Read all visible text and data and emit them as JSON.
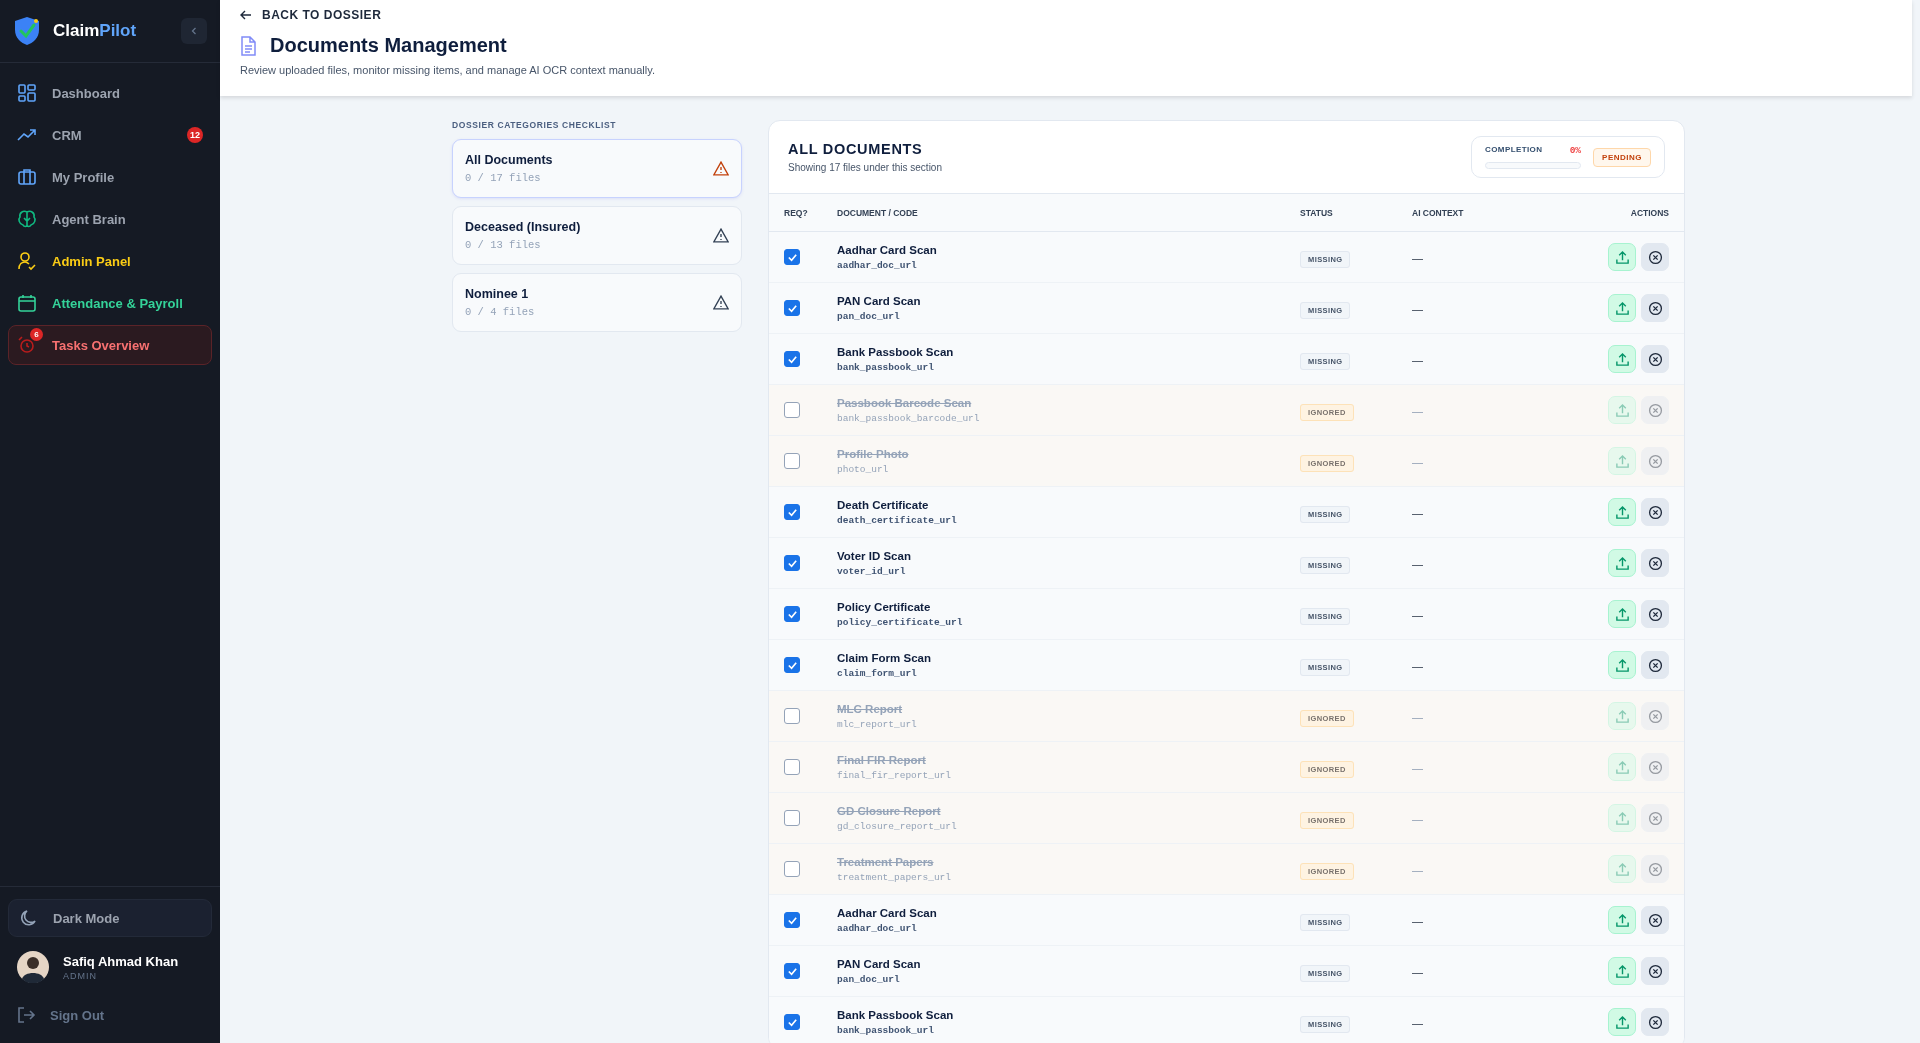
{
  "brand": {
    "name_part_1": "Claim",
    "name_part_2": "Pilot"
  },
  "sidebar": {
    "items": [
      {
        "label": "Dashboard",
        "color": "#9ca3af",
        "selected": false
      },
      {
        "label": "CRM",
        "color": "#9ca3af",
        "selected": false,
        "badge": "12"
      },
      {
        "label": "My Profile",
        "color": "#9ca3af",
        "selected": false
      },
      {
        "label": "Agent Brain",
        "color": "#9ca3af",
        "selected": false
      },
      {
        "label": "Admin Panel",
        "color": "#facc15",
        "selected": false
      },
      {
        "label": "Attendance & Payroll",
        "color": "#34d399",
        "selected": false
      },
      {
        "label": "Tasks Overview",
        "color": "#f87171",
        "selected": true,
        "badge": "6"
      }
    ],
    "dark_mode": {
      "label": "Dark Mode"
    },
    "user": {
      "name": "Safiq Ahmad Khan",
      "role": "ADMIN"
    },
    "sign_out": "Sign Out"
  },
  "header": {
    "back_link": "BACK TO DOSSIER",
    "title": "Documents Management",
    "subtitle": "Review uploaded files, monitor missing items, and manage AI OCR context manually."
  },
  "checklist": {
    "title": "DOSSIER CATEGORIES CHECKLIST",
    "categories": [
      {
        "name": "All Documents",
        "count": "0 / 17 files",
        "selected": true
      },
      {
        "name": "Deceased (Insured)",
        "count": "0 / 13 files",
        "selected": false
      },
      {
        "name": "Nominee 1",
        "count": "0 / 4 files",
        "selected": false
      }
    ]
  },
  "documents": {
    "title": "ALL DOCUMENTS",
    "subtitle": "Showing 17 files under this section",
    "completion": {
      "label": "COMPLETION",
      "value": "0%",
      "level": 0,
      "status": "PENDING"
    },
    "columns": [
      "REQ?",
      "DOCUMENT / CODE",
      "STATUS",
      "AI CONTEXT",
      "ACTIONS"
    ],
    "rows": [
      {
        "required": true,
        "name": "Aadhar Card Scan",
        "code": "aadhar_doc_url",
        "status": "MISSING",
        "ai_context": "—"
      },
      {
        "required": true,
        "name": "PAN Card Scan",
        "code": "pan_doc_url",
        "status": "MISSING",
        "ai_context": "—"
      },
      {
        "required": true,
        "name": "Bank Passbook Scan",
        "code": "bank_passbook_url",
        "status": "MISSING",
        "ai_context": "—"
      },
      {
        "required": false,
        "name": "Passbook Barcode Scan",
        "code": "bank_passbook_barcode_url",
        "status": "IGNORED",
        "ai_context": "—"
      },
      {
        "required": false,
        "name": "Profile Photo",
        "code": "photo_url",
        "status": "IGNORED",
        "ai_context": "—"
      },
      {
        "required": true,
        "name": "Death Certificate",
        "code": "death_certificate_url",
        "status": "MISSING",
        "ai_context": "—"
      },
      {
        "required": true,
        "name": "Voter ID Scan",
        "code": "voter_id_url",
        "status": "MISSING",
        "ai_context": "—"
      },
      {
        "required": true,
        "name": "Policy Certificate",
        "code": "policy_certificate_url",
        "status": "MISSING",
        "ai_context": "—"
      },
      {
        "required": true,
        "name": "Claim Form Scan",
        "code": "claim_form_url",
        "status": "MISSING",
        "ai_context": "—"
      },
      {
        "required": false,
        "name": "MLC Report",
        "code": "mlc_report_url",
        "status": "IGNORED",
        "ai_context": "—"
      },
      {
        "required": false,
        "name": "Final FIR Report",
        "code": "final_fir_report_url",
        "status": "IGNORED",
        "ai_context": "—"
      },
      {
        "required": false,
        "name": "GD Closure Report",
        "code": "gd_closure_report_url",
        "status": "IGNORED",
        "ai_context": "—"
      },
      {
        "required": false,
        "name": "Treatment Papers",
        "code": "treatment_papers_url",
        "status": "IGNORED",
        "ai_context": "—"
      },
      {
        "required": true,
        "name": "Aadhar Card Scan",
        "code": "aadhar_doc_url",
        "status": "MISSING",
        "ai_context": "—"
      },
      {
        "required": true,
        "name": "PAN Card Scan",
        "code": "pan_doc_url",
        "status": "MISSING",
        "ai_context": "—"
      },
      {
        "required": true,
        "name": "Bank Passbook Scan",
        "code": "bank_passbook_url",
        "status": "MISSING",
        "ai_context": "—"
      }
    ]
  }
}
